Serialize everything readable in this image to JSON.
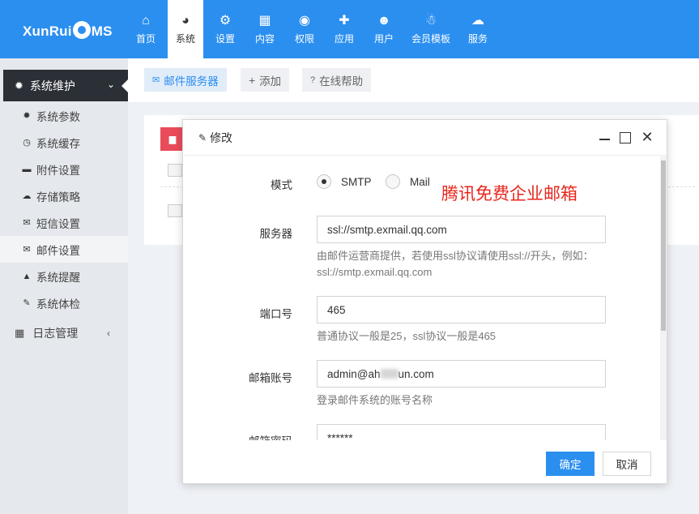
{
  "header": {
    "logo_prefix": "XunRui",
    "logo_suffix": "MS",
    "nav": [
      {
        "label": "首页",
        "icon": "home-icon",
        "glyph": "⌂"
      },
      {
        "label": "系统",
        "icon": "globe-icon",
        "glyph": "◕"
      },
      {
        "label": "设置",
        "icon": "gears-icon",
        "glyph": "⚙"
      },
      {
        "label": "内容",
        "icon": "grid-icon",
        "glyph": "▦"
      },
      {
        "label": "权限",
        "icon": "user-circle-icon",
        "glyph": "◉"
      },
      {
        "label": "应用",
        "icon": "puzzle-icon",
        "glyph": "✚"
      },
      {
        "label": "用户",
        "icon": "user-icon",
        "glyph": "☻"
      },
      {
        "label": "会员模板",
        "icon": "android-icon",
        "glyph": "☃"
      },
      {
        "label": "服务",
        "icon": "cloud-icon",
        "glyph": "☁"
      }
    ],
    "active_index": 1
  },
  "sidebar": {
    "group_title": "系统维护",
    "items": [
      {
        "label": "系统参数",
        "icon": "gear-icon",
        "glyph": "✹"
      },
      {
        "label": "系统缓存",
        "icon": "clock-icon",
        "glyph": "◷"
      },
      {
        "label": "附件设置",
        "icon": "folder-icon",
        "glyph": "▬"
      },
      {
        "label": "存储策略",
        "icon": "cloud-icon",
        "glyph": "☁"
      },
      {
        "label": "短信设置",
        "icon": "envelope-icon",
        "glyph": "✉"
      },
      {
        "label": "邮件设置",
        "icon": "envelope-open-icon",
        "glyph": "✉"
      },
      {
        "label": "系统提醒",
        "icon": "bell-icon",
        "glyph": "▲"
      },
      {
        "label": "系统体检",
        "icon": "wrench-icon",
        "glyph": "✎"
      }
    ],
    "active_item": "邮件设置",
    "group2_title": "日志管理"
  },
  "toolbar": {
    "mail_server": "邮件服务器",
    "add": "添加",
    "help": "在线帮助"
  },
  "modal": {
    "title": "修改",
    "mode_label": "模式",
    "mode_options": [
      "SMTP",
      "Mail"
    ],
    "mode_selected": "SMTP",
    "annotation": "腾讯免费企业邮箱",
    "server_label": "服务器",
    "server_value": "ssl://smtp.exmail.qq.com",
    "server_help": "由邮件运营商提供，若使用ssl协议请使用ssl://开头，例如：ssl://smtp.exmail.qq.com",
    "port_label": "端口号",
    "port_value": "465",
    "port_help": "普通协议一般是25，ssl协议一般是465",
    "account_label": "邮箱账号",
    "account_prefix": "admin@ah",
    "account_suffix": "un.com",
    "account_help": "登录邮件系统的账号名称",
    "password_label": "邮箱密码",
    "password_value": "******",
    "ok": "确定",
    "cancel": "取消"
  },
  "colors": {
    "brand": "#2b8ff0",
    "danger": "#e84c5a",
    "annotation": "#e8261c",
    "sidebar_dark": "#2b2f36"
  }
}
